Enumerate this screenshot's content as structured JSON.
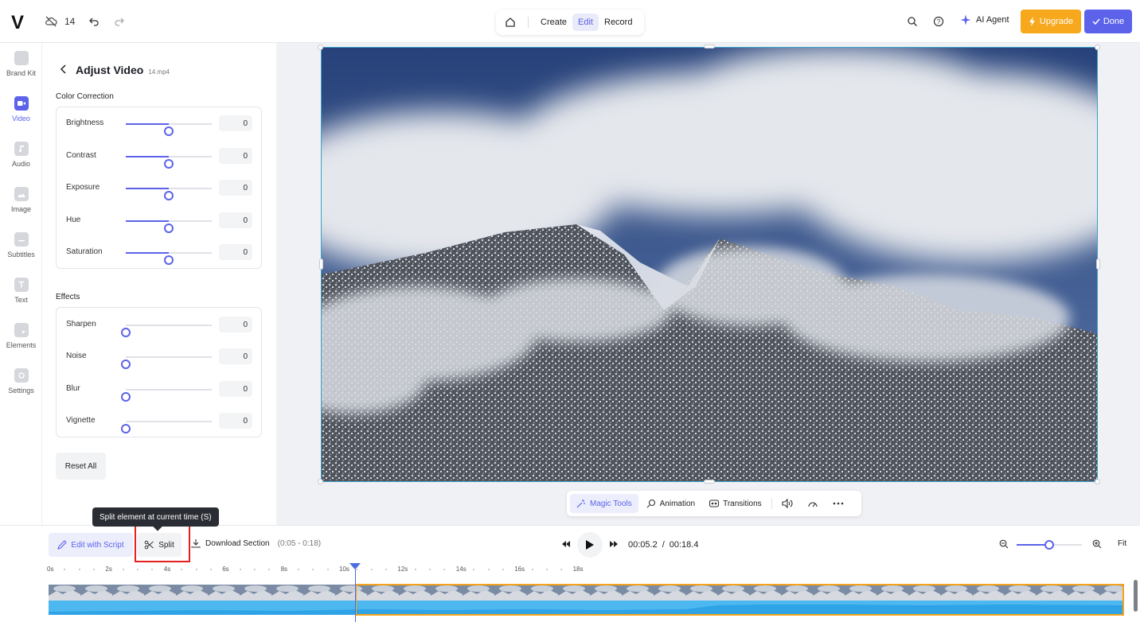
{
  "topbar": {
    "logo": "V",
    "version_count": "14",
    "modes": [
      {
        "label": "Create",
        "active": false
      },
      {
        "label": "Edit",
        "active": true
      },
      {
        "label": "Record",
        "active": false
      }
    ],
    "ai_agent_label": "AI Agent",
    "upgrade_label": "Upgrade",
    "done_label": "Done",
    "accent_color": "#5c63ea",
    "upgrade_color": "#f7a81d"
  },
  "rail": {
    "items": [
      {
        "label": "Brand Kit",
        "icon": "brand-kit-icon",
        "active": false
      },
      {
        "label": "Video",
        "icon": "video-icon",
        "active": true
      },
      {
        "label": "Audio",
        "icon": "audio-icon",
        "active": false
      },
      {
        "label": "Image",
        "icon": "image-icon",
        "active": false
      },
      {
        "label": "Subtitles",
        "icon": "subtitles-icon",
        "active": false
      },
      {
        "label": "Text",
        "icon": "text-icon",
        "active": false
      },
      {
        "label": "Elements",
        "icon": "elements-icon",
        "active": false
      },
      {
        "label": "Settings",
        "icon": "settings-icon",
        "active": false
      }
    ]
  },
  "panel": {
    "title": "Adjust Video",
    "file": "14.mp4",
    "color_section": "Color Correction",
    "color_sliders": [
      {
        "label": "Brightness",
        "value": "0",
        "level": 0.5
      },
      {
        "label": "Contrast",
        "value": "0",
        "level": 0.5
      },
      {
        "label": "Exposure",
        "value": "0",
        "level": 0.5
      },
      {
        "label": "Hue",
        "value": "0",
        "level": 0.5
      },
      {
        "label": "Saturation",
        "value": "0",
        "level": 0.5
      }
    ],
    "effects_section": "Effects",
    "effect_sliders": [
      {
        "label": "Sharpen",
        "value": "0",
        "level": 0
      },
      {
        "label": "Noise",
        "value": "0",
        "level": 0
      },
      {
        "label": "Blur",
        "value": "0",
        "level": 0
      },
      {
        "label": "Vignette",
        "value": "0",
        "level": 0
      }
    ],
    "reset_label": "Reset All"
  },
  "tools": {
    "magic_tools": "Magic Tools",
    "animation": "Animation",
    "transitions": "Transitions"
  },
  "timeline": {
    "tooltip": "Split element at current time (S)",
    "edit_with_script": "Edit with Script",
    "split": "Split",
    "download_section": "Download Section",
    "download_range": "(0:05 - 0:18)",
    "current_time": "00:05.2",
    "separator": "/",
    "total_time": "00:18.4",
    "fit": "Fit",
    "zoom_level": 0.5,
    "ticks": [
      "0s",
      "2s",
      "4s",
      "6s",
      "8s",
      "10s",
      "12s",
      "14s",
      "16s",
      "18s"
    ],
    "selection_color": "#f5a31a",
    "playhead_color": "#4a6ce0"
  }
}
